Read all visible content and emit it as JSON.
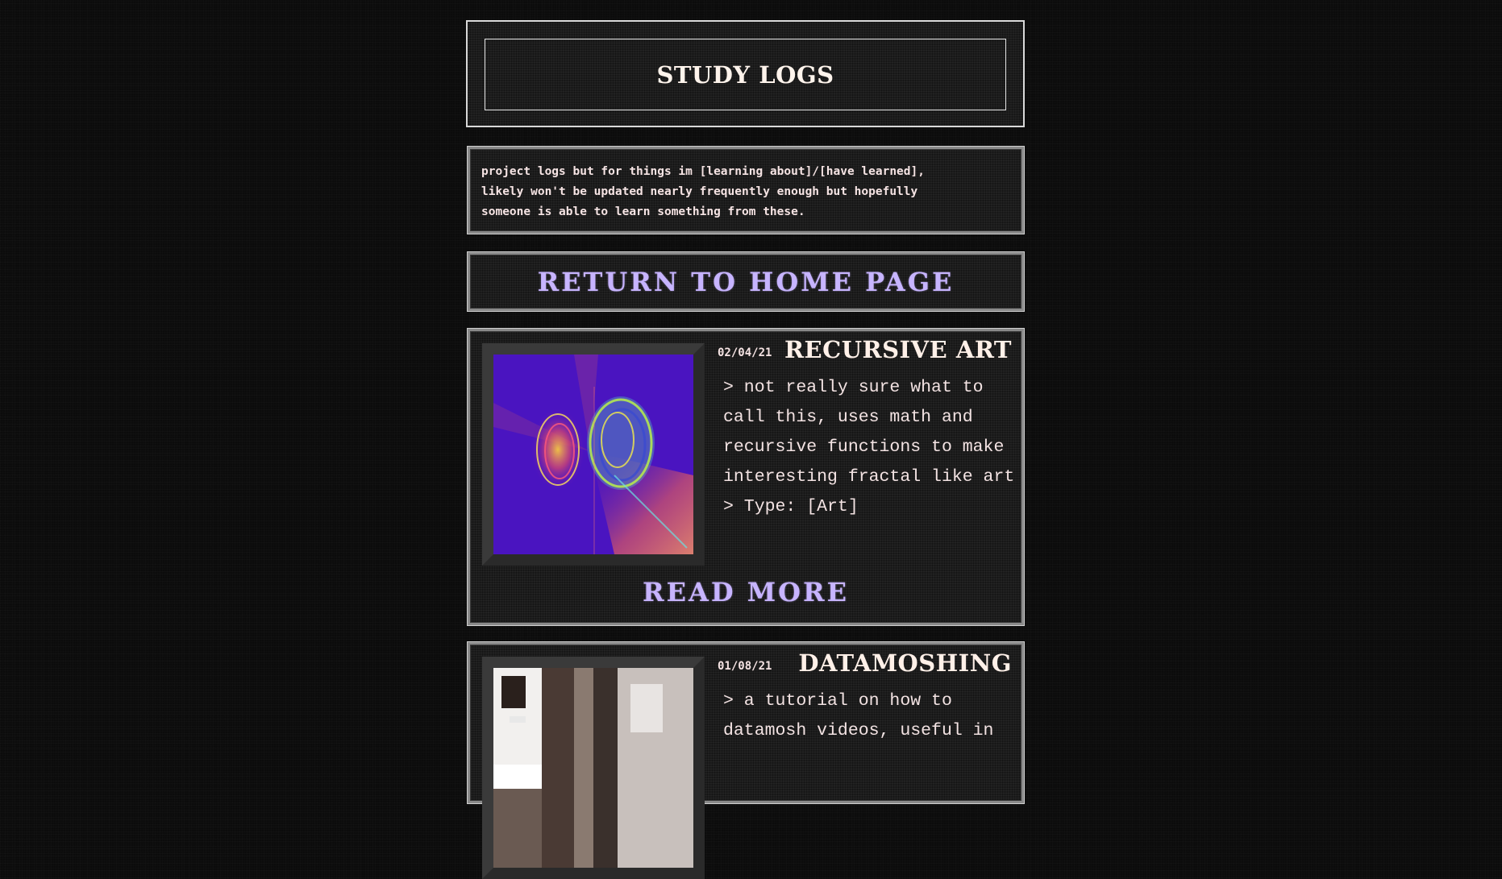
{
  "header": {
    "title": "STUDY LOGS"
  },
  "intro": {
    "text": "project logs but for things im [learning about]/[have learned],\nlikely won't be updated nearly frequently enough but hopefully\nsomeone is able to learn something from these."
  },
  "nav": {
    "home_label": "RETURN TO HOME PAGE"
  },
  "logs": [
    {
      "date": "02/04/21",
      "title": "RECURSIVE ART",
      "summary": ">  not really sure what to call this, uses math and recursive functions to make interesting fractal like art",
      "type": "> Type: [Art]",
      "read_more": "READ MORE",
      "thumbnail": "recursive-fractal-art",
      "thumb_bg": "#4a14c0"
    },
    {
      "date": "01/08/21",
      "title": "DATAMOSHING",
      "summary": ">  a tutorial on how to datamosh videos, useful in",
      "thumbnail": "datamosh-glitch-frame"
    }
  ],
  "colors": {
    "link": "#c7b4ff",
    "text": "#f3e3e3",
    "panel_bg": "#1c1c1c",
    "page_bg": "#0b0b0b"
  }
}
